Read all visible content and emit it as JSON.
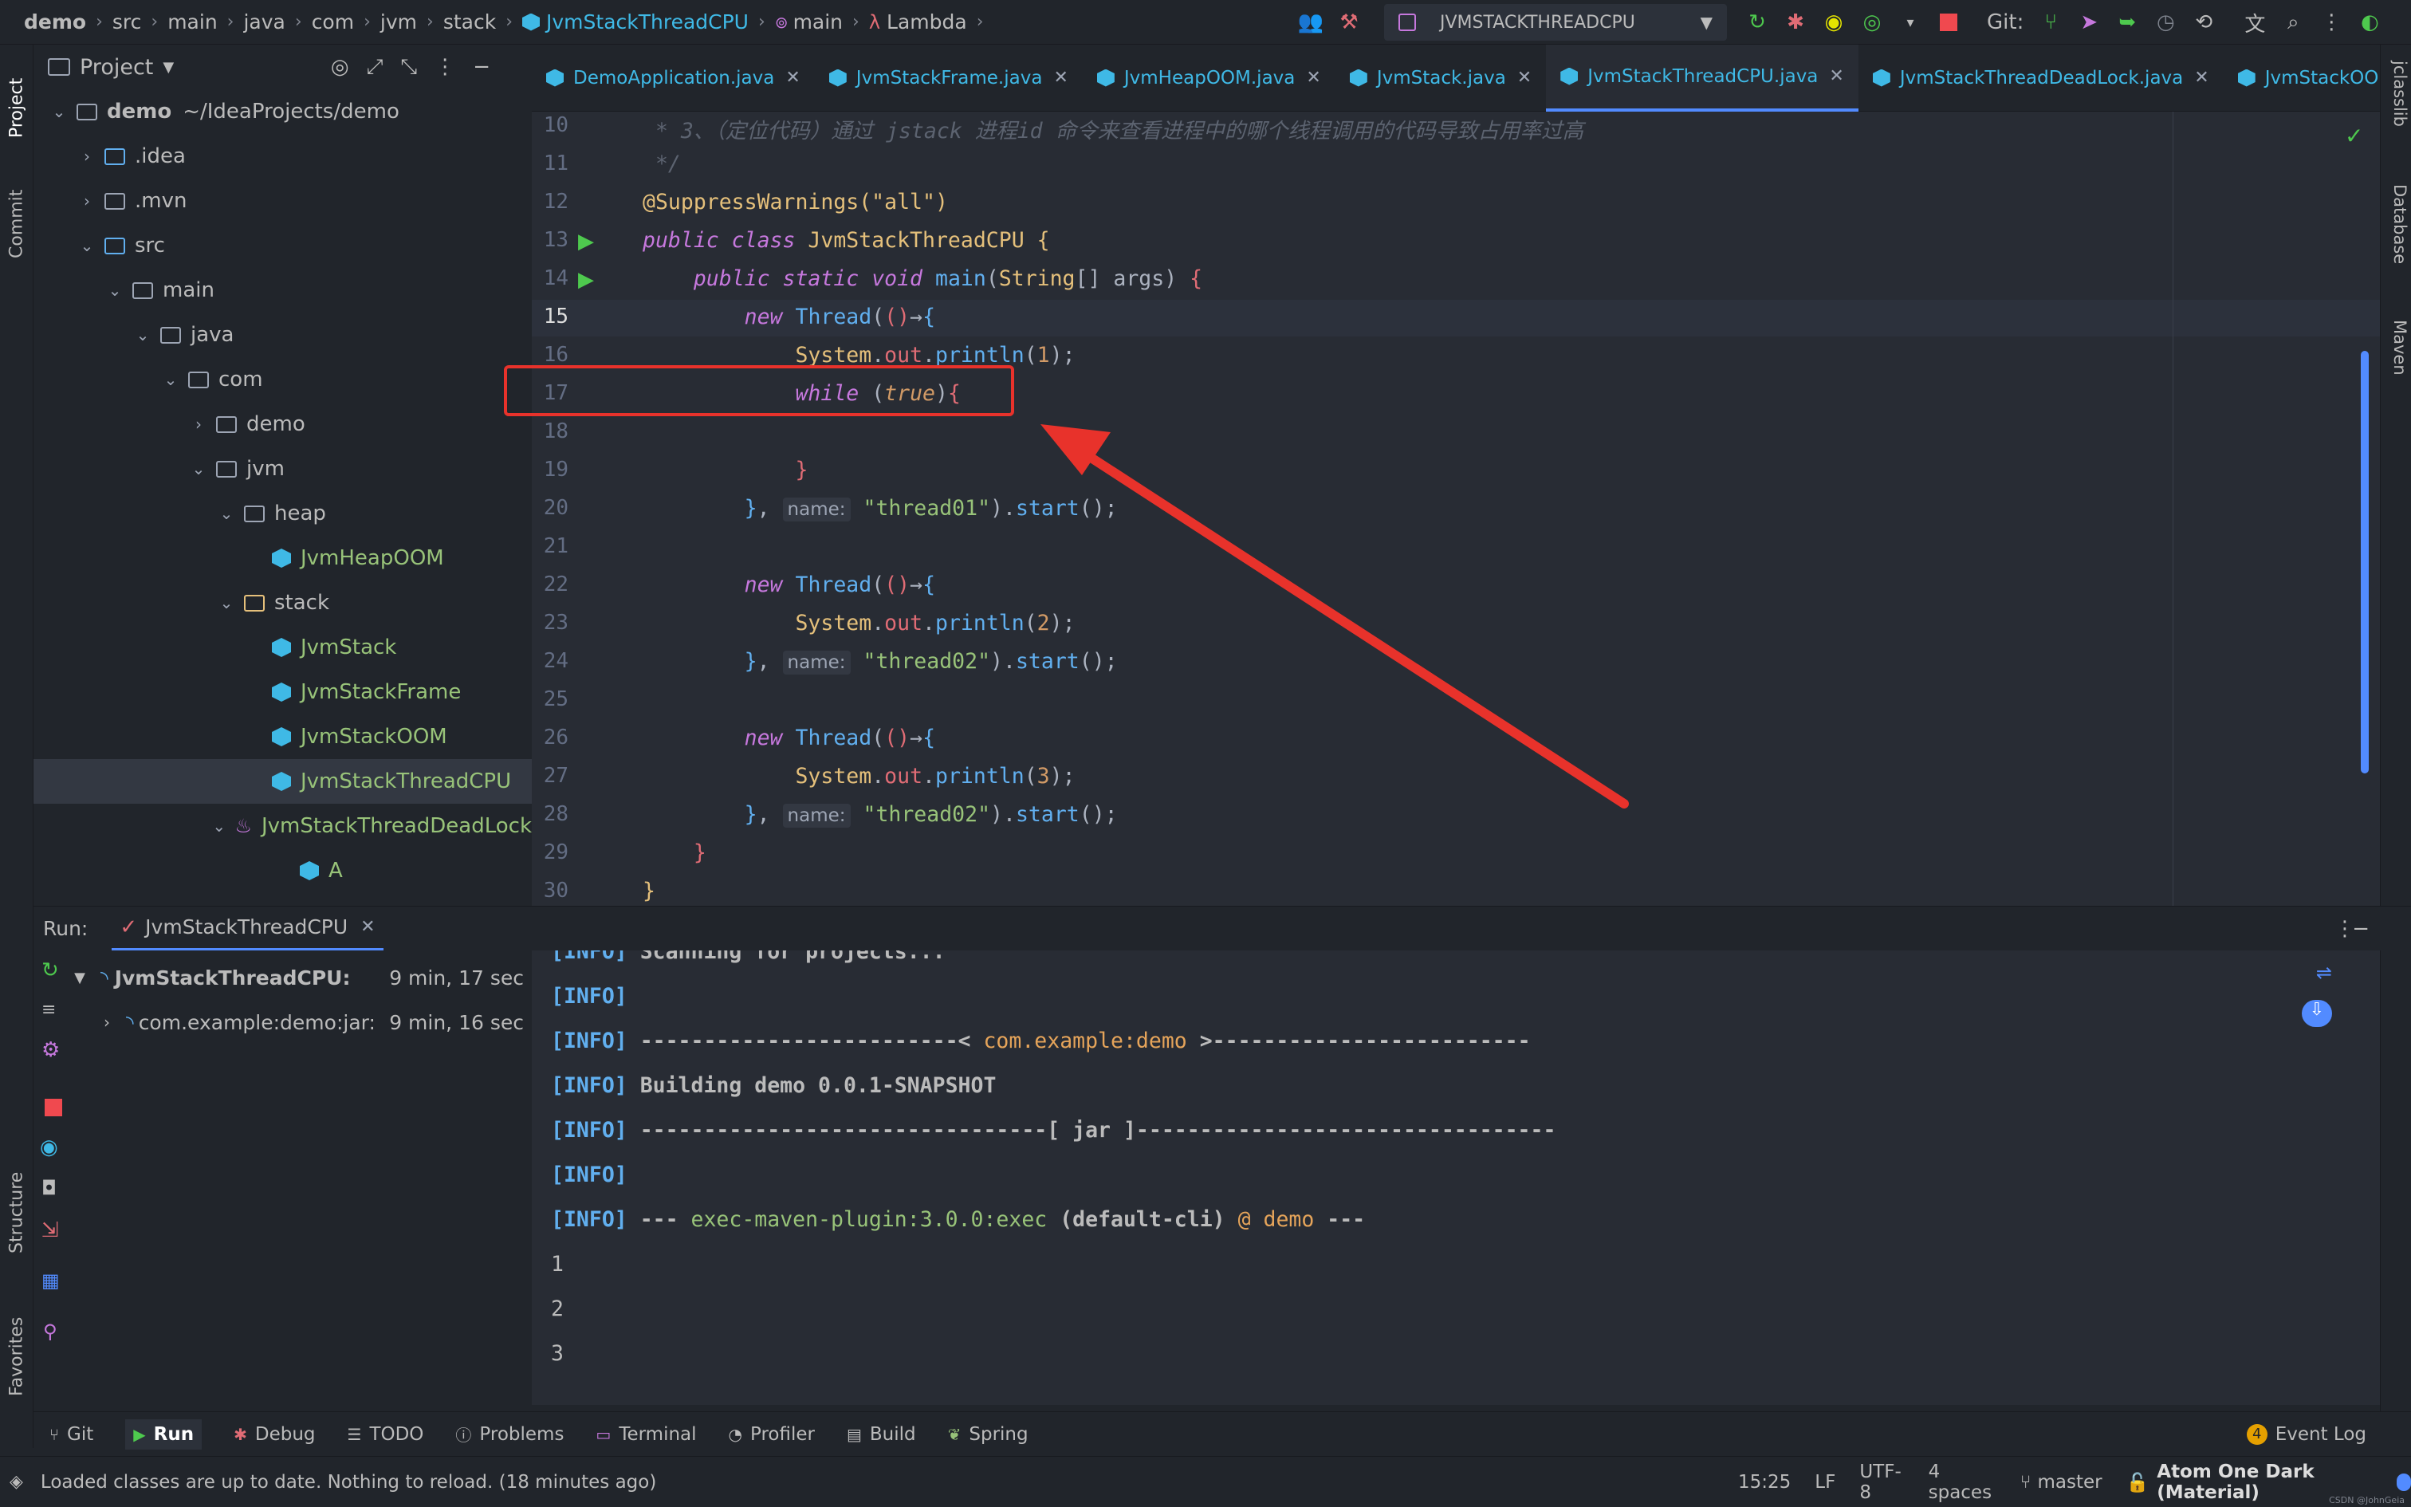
{
  "breadcrumb": [
    "demo",
    "src",
    "main",
    "java",
    "com",
    "jvm",
    "stack",
    "JvmStackThreadCPU",
    "main",
    "Lambda"
  ],
  "run_config": "JVMSTACKTHREADCPU",
  "git_label": "Git:",
  "colors": {
    "accent": "#528bff",
    "red_annotation": "#e8322b",
    "class_icon": "#3fb9e6",
    "run_green": "#4ec94e"
  },
  "project": {
    "title": "Project",
    "tree": [
      {
        "label": "demo",
        "suffix": "~/IdeaProjects/demo",
        "kind": "module",
        "depth": 0,
        "arrow": "open"
      },
      {
        "label": ".idea",
        "kind": "folder",
        "depth": 1,
        "arrow": "closed"
      },
      {
        "label": ".mvn",
        "kind": "folder",
        "depth": 1,
        "arrow": "closed"
      },
      {
        "label": "src",
        "kind": "folder",
        "depth": 1,
        "arrow": "open"
      },
      {
        "label": "main",
        "kind": "folder",
        "depth": 2,
        "arrow": "open"
      },
      {
        "label": "java",
        "kind": "folder",
        "depth": 3,
        "arrow": "open"
      },
      {
        "label": "com",
        "kind": "folder",
        "depth": 4,
        "arrow": "open"
      },
      {
        "label": "demo",
        "kind": "folder",
        "depth": 5,
        "arrow": "closed"
      },
      {
        "label": "jvm",
        "kind": "folder",
        "depth": 5,
        "arrow": "open"
      },
      {
        "label": "heap",
        "kind": "folder",
        "depth": 6,
        "arrow": "open"
      },
      {
        "label": "JvmHeapOOM",
        "kind": "class",
        "depth": 7,
        "arrow": "none"
      },
      {
        "label": "stack",
        "kind": "folder",
        "depth": 6,
        "arrow": "open"
      },
      {
        "label": "JvmStack",
        "kind": "class",
        "depth": 7,
        "arrow": "none"
      },
      {
        "label": "JvmStackFrame",
        "kind": "class",
        "depth": 7,
        "arrow": "none"
      },
      {
        "label": "JvmStackOOM",
        "kind": "class",
        "depth": 7,
        "arrow": "none"
      },
      {
        "label": "JvmStackThreadCPU",
        "kind": "class",
        "depth": 7,
        "arrow": "none",
        "selected": true
      },
      {
        "label": "JvmStackThreadDeadLock",
        "kind": "java",
        "depth": 7,
        "arrow": "open"
      },
      {
        "label": "A",
        "kind": "class",
        "depth": 8,
        "arrow": "none"
      }
    ]
  },
  "tabs": [
    {
      "label": "DemoApplication.java"
    },
    {
      "label": "JvmStackFrame.java"
    },
    {
      "label": "JvmHeapOOM.java"
    },
    {
      "label": "JvmStack.java"
    },
    {
      "label": "JvmStackThreadCPU.java",
      "active": true
    },
    {
      "label": "JvmStackThreadDeadLock.java"
    },
    {
      "label": "JvmStackOOM.java"
    }
  ],
  "editor": {
    "line_numbers": [
      "10",
      "11",
      "12",
      "13",
      "14",
      "15",
      "16",
      "17",
      "18",
      "19",
      "20",
      "21",
      "22",
      "23",
      "24",
      "25",
      "26",
      "27",
      "28",
      "29",
      "30"
    ],
    "comment_line": " * 3、（定位代码）通过 jstack 进程id 命令来查看进程中的哪个线程调用的代码导致占用率过高",
    "comment_end": " */",
    "annotation": "@SuppressWarnings(\"all\")",
    "hint_name": "name:",
    "thread01": "\"thread01\"",
    "thread02": "\"thread02\""
  },
  "run": {
    "label": "Run:",
    "tab": "JvmStackThreadCPU",
    "tree": [
      {
        "label": "JvmStackThreadCPU:",
        "time": "9 min, 17 sec"
      },
      {
        "label": "com.example:demo:jar:",
        "time": "9 min, 16 sec"
      }
    ],
    "console": [
      "[INFO] Scanning for projects...",
      "[INFO]",
      "[INFO] -------------------------< com.example:demo >-------------------------",
      "[INFO] Building demo 0.0.1-SNAPSHOT",
      "[INFO] --------------------------------[ jar ]---------------------------------",
      "[INFO]",
      "[INFO] --- exec-maven-plugin:3.0.0:exec (default-cli) @ demo ---",
      "1",
      "2",
      "3"
    ]
  },
  "tool_windows": [
    "Git",
    "Run",
    "Debug",
    "TODO",
    "Problems",
    "Terminal",
    "Profiler",
    "Build",
    "Spring"
  ],
  "event_log": {
    "count": "4",
    "label": "Event Log"
  },
  "side_tabs_left": [
    "Project",
    "Commit",
    "Structure",
    "Favorites"
  ],
  "side_tabs_right": [
    "jclasslib",
    "Database",
    "Maven"
  ],
  "status": {
    "message": "Loaded classes are up to date. Nothing to reload. (18 minutes ago)",
    "position": "15:25",
    "line_sep": "LF",
    "encoding": "UTF-8",
    "indent": "4 spaces",
    "branch": "master",
    "theme": "Atom One Dark (Material)",
    "watermark": "CSDN @JohnGeia"
  }
}
